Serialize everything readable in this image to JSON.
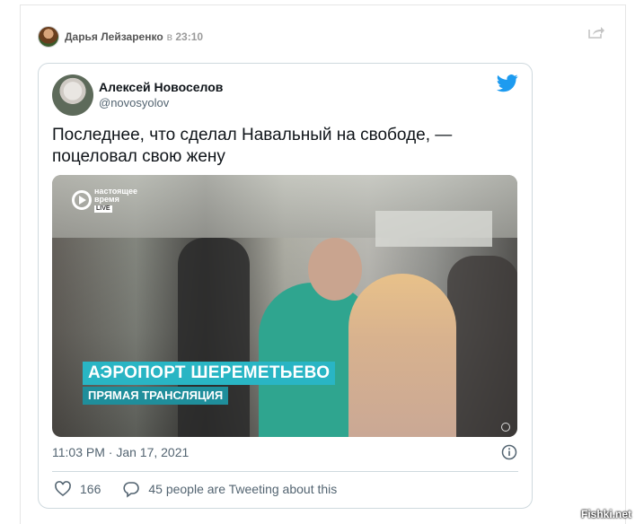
{
  "post": {
    "author": "Дарья Лейзаренко",
    "time_prefix": "в",
    "time": "23:10"
  },
  "tweet": {
    "name": "Алексей Новоселов",
    "handle": "@novosyolov",
    "text": "Последнее, что сделал Навальный на свободе, — поцеловал свою жену",
    "timestamp": "11:03 PM · Jan 17, 2021",
    "likes": "166",
    "replies_label": "45 people are Tweeting about this",
    "media": {
      "channel_name_line1": "настоящее",
      "channel_name_line2": "время",
      "channel_live": "LIVE",
      "lower_title": "АЭРОПОРТ ШЕРЕМЕТЬЕВО",
      "lower_subtitle": "ПРЯМАЯ ТРАНСЛЯЦИЯ"
    }
  },
  "icons": {
    "share": "share-icon",
    "twitter": "twitter-bird-icon",
    "info": "info-icon",
    "heart": "heart-icon",
    "reply": "reply-icon"
  },
  "colors": {
    "twitter_blue": "#1d9bf0",
    "lower_third": "#29b5c4"
  },
  "watermark": "Fishki.net"
}
